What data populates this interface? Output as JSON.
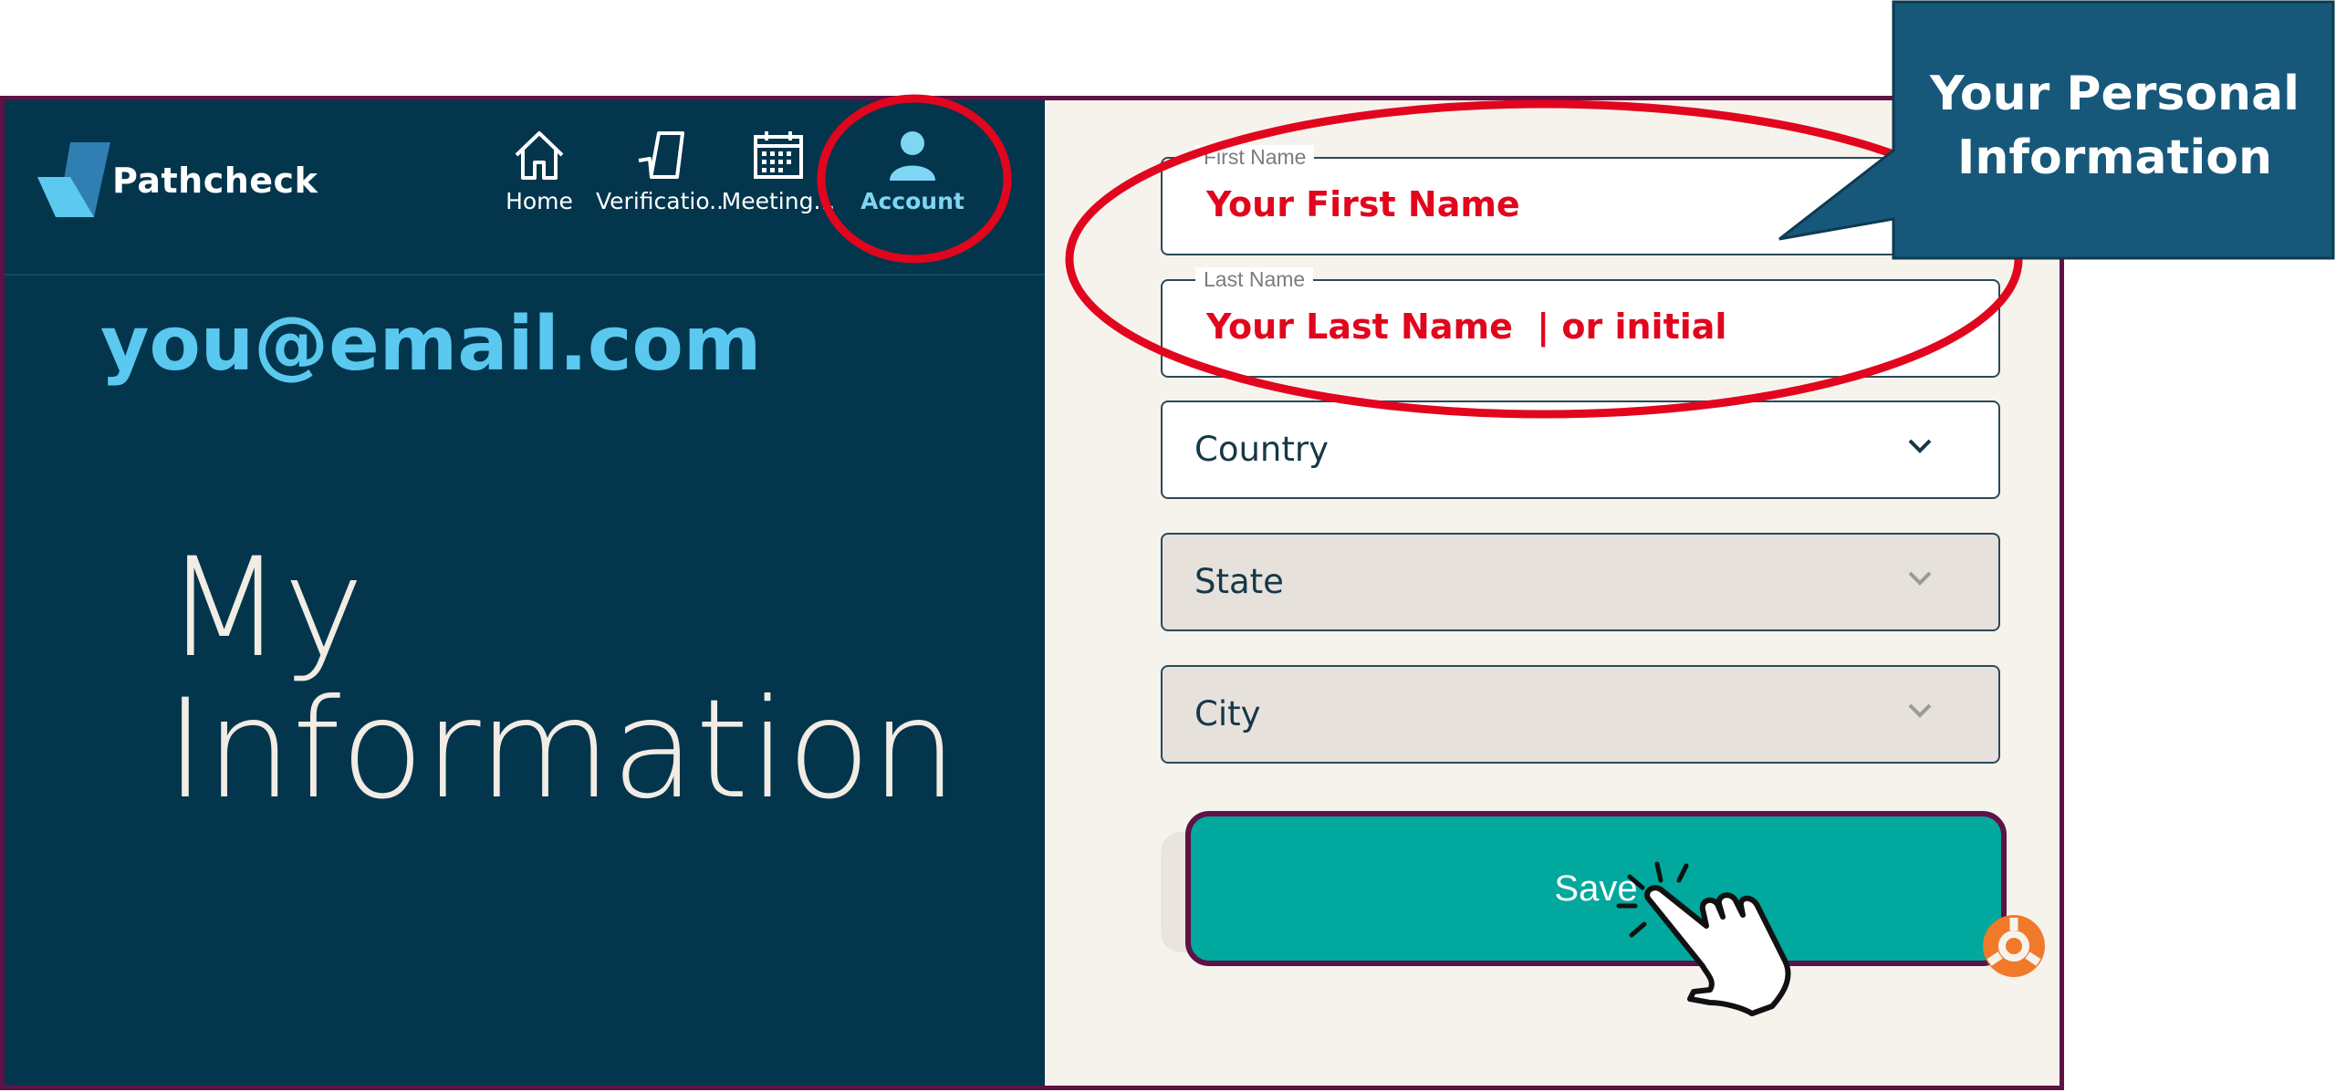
{
  "brand": {
    "name": "Pathcheck"
  },
  "nav": {
    "items": [
      {
        "label": "Home",
        "icon": "home-icon"
      },
      {
        "label": "Verificatio...",
        "icon": "checkmark-icon"
      },
      {
        "label": "Meeting...",
        "icon": "calendar-icon"
      },
      {
        "label": "Account",
        "icon": "person-icon",
        "active": true
      }
    ]
  },
  "account": {
    "email": "you@email.com"
  },
  "page": {
    "title_line1": "My",
    "title_line2": "Information"
  },
  "form": {
    "first_name": {
      "label": "First Name",
      "value": "Your First Name"
    },
    "last_name": {
      "label": "Last Name",
      "value": "Your Last Name  | or initial"
    },
    "country": {
      "placeholder": "Country"
    },
    "state": {
      "placeholder": "State"
    },
    "city": {
      "placeholder": "City"
    },
    "save_label": "Save"
  },
  "callout": {
    "line1": "Your Personal",
    "line2": "Information"
  },
  "colors": {
    "panel": "#03354d",
    "form_bg": "#f6f3ed",
    "accent_blue": "#5ac8ef",
    "save": "#00a89d",
    "highlight_red": "#e1061d",
    "frame": "#5e1245",
    "callout": "#17587a"
  }
}
